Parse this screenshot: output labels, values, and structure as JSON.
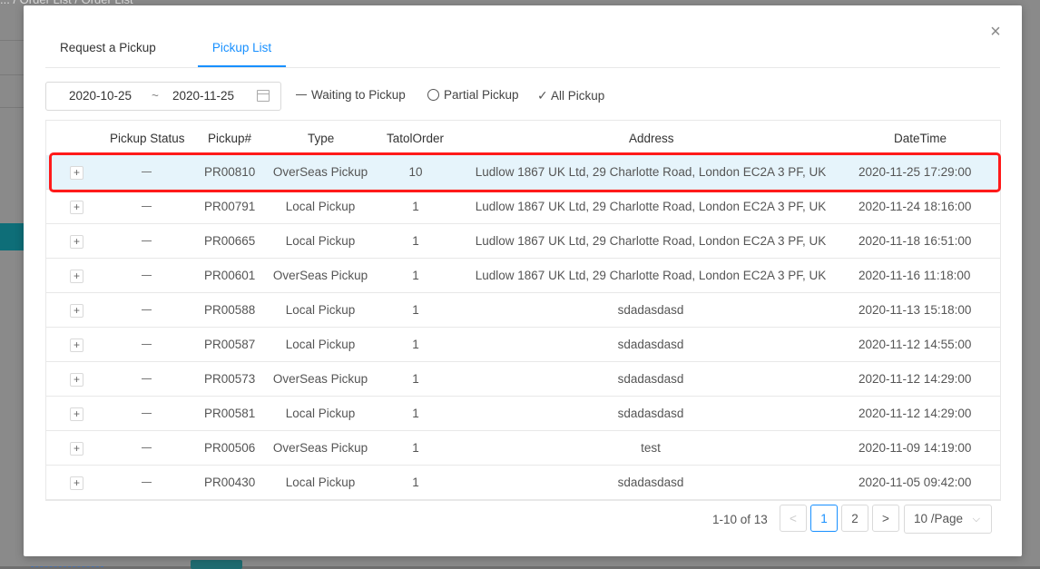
{
  "background": {
    "breadcrumb": "... / Order List / Order List"
  },
  "modal": {
    "close_icon": "×",
    "tabs": [
      "Request a Pickup",
      "Pickup List"
    ],
    "active_tab": 1,
    "date_range": {
      "start": "2020-10-25",
      "separator": "~",
      "end": "2020-11-25"
    },
    "filters": [
      "Waiting to Pickup",
      "Partial Pickup",
      "All Pickup"
    ],
    "table": {
      "headers": [
        "Pickup Status",
        "Pickup#",
        "Type",
        "TatolOrder",
        "Address",
        "DateTime"
      ],
      "rows": [
        {
          "pickup": "PR00810",
          "type": "OverSeas Pickup",
          "total": "10",
          "address": "Ludlow 1867 UK Ltd, 29 Charlotte Road, London EC2A 3 PF, UK",
          "datetime": "2020-11-25 17:29:00"
        },
        {
          "pickup": "PR00791",
          "type": "Local Pickup",
          "total": "1",
          "address": "Ludlow 1867 UK Ltd, 29 Charlotte Road, London EC2A 3 PF, UK",
          "datetime": "2020-11-24 18:16:00"
        },
        {
          "pickup": "PR00665",
          "type": "Local Pickup",
          "total": "1",
          "address": "Ludlow 1867 UK Ltd, 29 Charlotte Road, London EC2A 3 PF, UK",
          "datetime": "2020-11-18 16:51:00"
        },
        {
          "pickup": "PR00601",
          "type": "OverSeas Pickup",
          "total": "1",
          "address": "Ludlow 1867 UK Ltd, 29 Charlotte Road, London EC2A 3 PF, UK",
          "datetime": "2020-11-16 11:18:00"
        },
        {
          "pickup": "PR00588",
          "type": "Local Pickup",
          "total": "1",
          "address": "sdadasdasd",
          "datetime": "2020-11-13 15:18:00"
        },
        {
          "pickup": "PR00587",
          "type": "Local Pickup",
          "total": "1",
          "address": "sdadasdasd",
          "datetime": "2020-11-12 14:55:00"
        },
        {
          "pickup": "PR00573",
          "type": "OverSeas Pickup",
          "total": "1",
          "address": "sdadasdasd",
          "datetime": "2020-11-12 14:29:00"
        },
        {
          "pickup": "PR00581",
          "type": "Local Pickup",
          "total": "1",
          "address": "sdadasdasd",
          "datetime": "2020-11-12 14:29:00"
        },
        {
          "pickup": "PR00506",
          "type": "OverSeas Pickup",
          "total": "1",
          "address": "test",
          "datetime": "2020-11-09 14:19:00"
        },
        {
          "pickup": "PR00430",
          "type": "Local Pickup",
          "total": "1",
          "address": "sdadasdasd",
          "datetime": "2020-11-05 09:42:00"
        }
      ]
    },
    "pagination": {
      "summary": "1-10 of 13",
      "prev": "<",
      "pages": [
        "1",
        "2"
      ],
      "current": "1",
      "next": ">",
      "page_size": "10 /Page"
    }
  }
}
